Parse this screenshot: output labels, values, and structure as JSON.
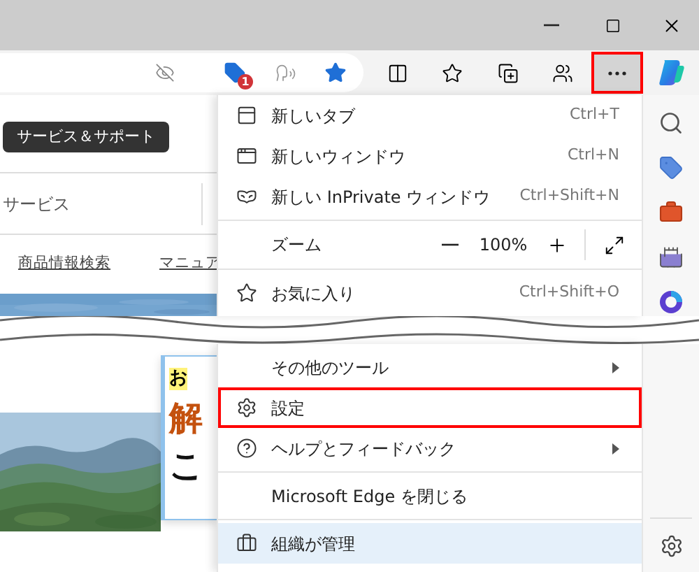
{
  "toolbar": {
    "notification_badge": "1",
    "more_button": {
      "highlighted": true
    }
  },
  "page": {
    "support_button": "サービス＆サポート",
    "nav_label": "サービス",
    "links": [
      "商品情報検索",
      "マニュア"
    ],
    "banner": {
      "line_1": "お",
      "line_2": "解",
      "line_3": "こ"
    }
  },
  "menu": {
    "top": [
      {
        "kind": "tab",
        "label": "新しいタブ",
        "shortcut": "Ctrl+T",
        "highlighted": false
      },
      {
        "kind": "window",
        "label": "新しいウィンドウ",
        "shortcut": "Ctrl+N",
        "highlighted": false
      },
      {
        "kind": "private",
        "label": "新しい InPrivate ウィンドウ",
        "shortcut": "Ctrl+Shift+N",
        "highlighted": false
      },
      {
        "kind": "separator"
      },
      {
        "kind": "zoom",
        "label": "ズーム",
        "value": "100%",
        "highlighted": false
      },
      {
        "kind": "separator"
      },
      {
        "kind": "favorites",
        "label": "お気に入り",
        "shortcut": "Ctrl+Shift+O",
        "highlighted": false
      }
    ],
    "bottom": [
      {
        "kind": "tools",
        "label": "その他のツール",
        "highlighted": false
      },
      {
        "kind": "settings",
        "label": "設定",
        "highlighted": true
      },
      {
        "kind": "help",
        "label": "ヘルプとフィードバック",
        "highlighted": false
      },
      {
        "kind": "separator"
      },
      {
        "kind": "close",
        "label": "Microsoft Edge を閉じる",
        "highlighted": false
      },
      {
        "kind": "separator"
      },
      {
        "kind": "managed",
        "label": "組織が管理",
        "highlighted": false
      }
    ]
  }
}
